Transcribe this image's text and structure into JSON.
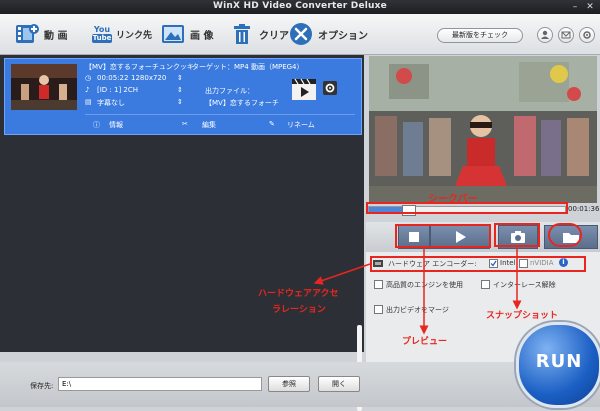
{
  "window": {
    "title": "WinX HD Video Converter Deluxe"
  },
  "toolbar": {
    "video_label": "動 画",
    "youtube_badge_top": "You",
    "youtube_badge_bottom": "Tube",
    "link_label": "リンク先",
    "image_label": "画 像",
    "clear_label": "クリア",
    "options_label": "オプション",
    "update_label": "最新版をチェック"
  },
  "item": {
    "title": "【MV】恋するフォーチュンクッキ",
    "target_label": "ターゲット：MP4 動画（MPEG4）",
    "duration": "00:05:22",
    "resolution": "1280x720",
    "audio": "[ID : 1] 2CH",
    "subtitle": "字幕なし",
    "output_label": "出力ファイル：",
    "output_name": "【MV】恋するフォーチ",
    "info_label": "情報",
    "edit_label": "編集",
    "rename_label": "リネーム"
  },
  "player": {
    "time": "00:01:36",
    "progress": 0.2
  },
  "options": {
    "hw_encoder_label": "ハードウェア エンコーダー:",
    "intel_label": "Intel",
    "intel_checked": true,
    "nvidia_label": "nVIDIA",
    "high_quality_label": "高品質のエンジンを使用",
    "deinterlace_label": "インターレース解除",
    "merge_label": "出力ビデオをマージ"
  },
  "bottom": {
    "save_label": "保存先:",
    "save_path": "E:\\",
    "browse_label": "参照",
    "open_label": "開く",
    "run_label": "RUN"
  },
  "annotations": {
    "seekbar": "シークバー",
    "hw_accel_line1": "ハードウェアアクセ",
    "hw_accel_line2": "ラレーション",
    "preview": "プレビュー",
    "snapshot": "スナップショット"
  },
  "colors": {
    "item_highlight": "#3b7be0",
    "annotation": "#e8261f",
    "run_button": "#1b5fc4"
  }
}
